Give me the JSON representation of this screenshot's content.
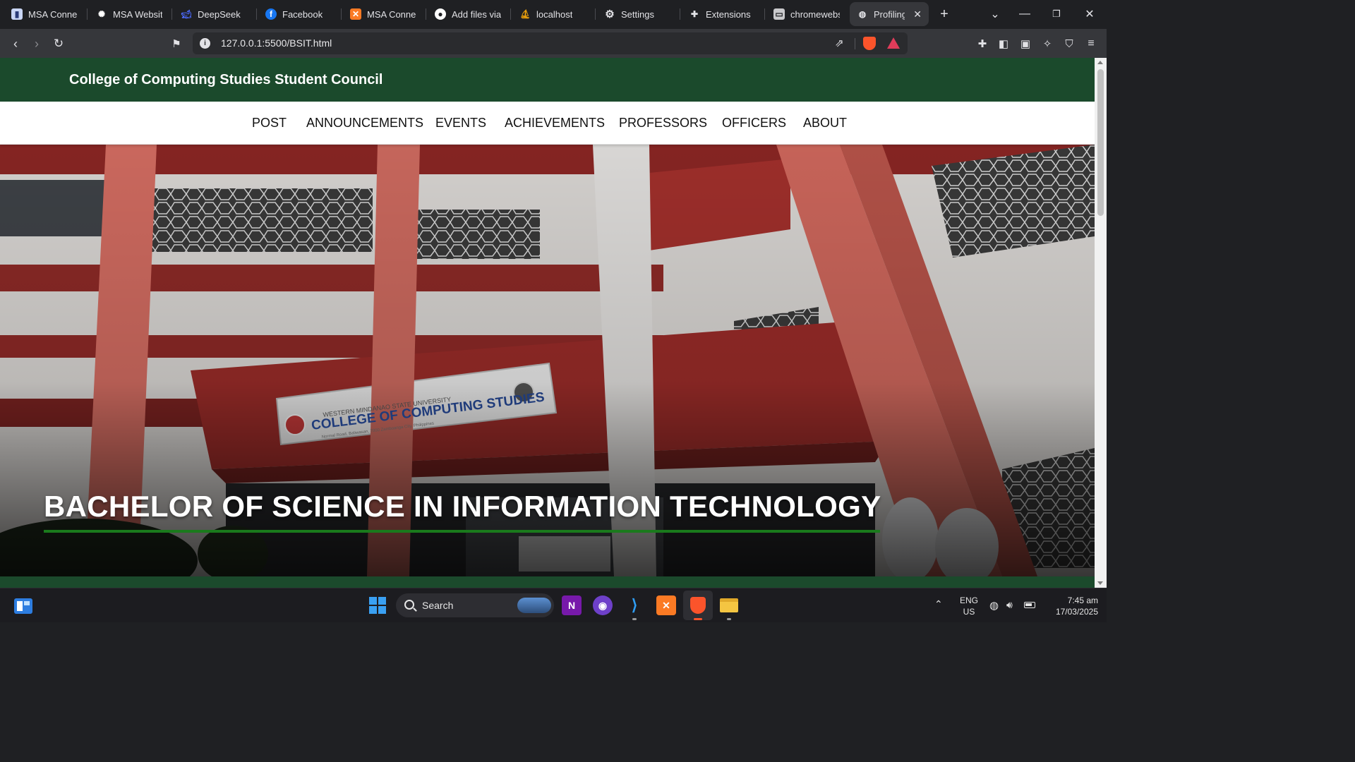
{
  "browser": {
    "tabs": [
      {
        "label": "MSA Connec",
        "icon": "msa-icon",
        "color": "#c9d6f5"
      },
      {
        "label": "MSA Website",
        "icon": "openai-icon",
        "color": "#ffffff"
      },
      {
        "label": "DeepSeek",
        "icon": "deepseek-icon",
        "color": "#4d6bfe"
      },
      {
        "label": "Facebook",
        "icon": "facebook-icon",
        "color": "#1877f2"
      },
      {
        "label": "MSA Connec",
        "icon": "xampp-icon",
        "color": "#fb7a24"
      },
      {
        "label": "Add files via",
        "icon": "github-icon",
        "color": "#ffffff"
      },
      {
        "label": "localhost",
        "icon": "phpmyadmin-icon",
        "color": "#f0a30a"
      },
      {
        "label": "Settings",
        "icon": "gear-icon",
        "color": "#e2e2e6"
      },
      {
        "label": "Extensions",
        "icon": "puzzle-icon",
        "color": "#e2e2e6"
      },
      {
        "label": "chromewebs",
        "icon": "page-icon",
        "color": "#e2e2e6"
      },
      {
        "label": "Profiling",
        "icon": "globe-icon",
        "color": "#e2e2e6",
        "active": true
      }
    ],
    "url": "127.0.0.1:5500/BSIT.html"
  },
  "site": {
    "title": "College of Computing Studies Student Council",
    "nav": [
      "POST",
      "ANNOUNCEMENTS",
      "EVENTS",
      "ACHIEVEMENTS",
      "PROFESSORS",
      "OFFICERS",
      "ABOUT"
    ],
    "hero": {
      "title": "BACHELOR OF SCIENCE IN INFORMATION TECHNOLOGY",
      "sign_arc": "WESTERN MINDANAO STATE UNIVERSITY",
      "sign_text": "COLLEGE OF COMPUTING STUDIES",
      "sign_small": "Normal Road, Baliwasan, 7000 Zamboanga City, Philippines"
    },
    "colors": {
      "header_green": "#1b4a2c",
      "underline_green": "#1a7a1c",
      "building_red": "#8e2a28"
    }
  },
  "taskbar": {
    "search_label": "Search",
    "lang_line1": "ENG",
    "lang_line2": "US",
    "time": "7:45 am",
    "date": "17/03/2025"
  }
}
